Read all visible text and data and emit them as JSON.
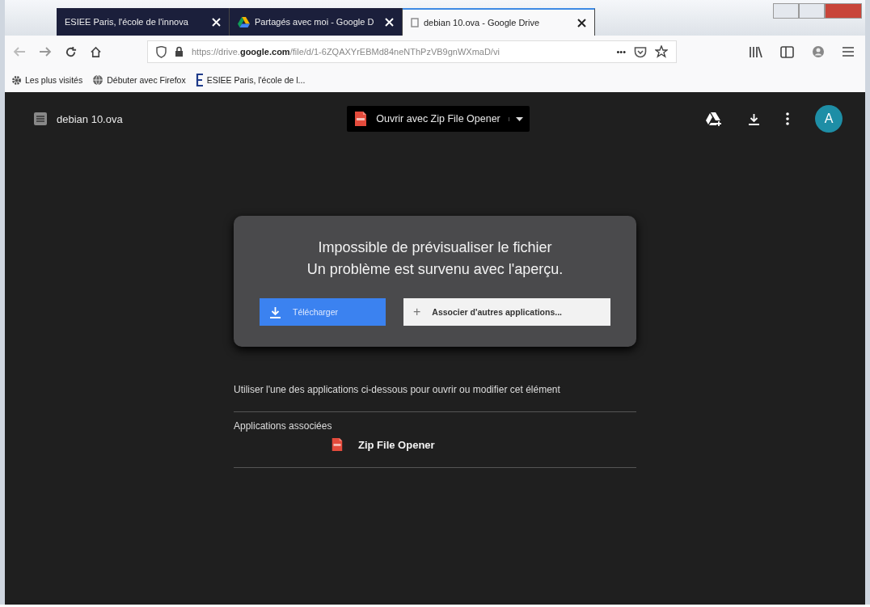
{
  "browser": {
    "tabs": [
      {
        "label": "ESIEE Paris, l'école de l'innova",
        "selected": false
      },
      {
        "label": "Partagés avec moi - Google D",
        "selected": false
      },
      {
        "label": "debian 10.ova - Google Drive",
        "selected": true
      }
    ],
    "url": {
      "prefix": "https://drive.",
      "domain": "google.com",
      "rest": "/file/d/1-6ZQAXYrEBMd84neNThPzVB9gnWXmaD/vi"
    },
    "overflow": "•••",
    "bookmarks": [
      {
        "label": "Les plus visités"
      },
      {
        "label": "Débuter avec Firefox"
      },
      {
        "label": "ESIEE Paris, l'école de l..."
      }
    ]
  },
  "drive": {
    "file_name": "debian 10.ova",
    "open_with": "Ouvrir avec Zip File Opener",
    "avatar": "A",
    "error": {
      "title": "Impossible de prévisualiser le fichier",
      "message": "Un problème est survenu avec l'aperçu.",
      "download": "Télécharger",
      "associate_icon": "+",
      "associate": "Associer d'autres applications..."
    },
    "apps_intro": "Utiliser l'une des applications ci-dessous pour ouvrir ou modifier cet élément",
    "apps_heading": "Applications associées",
    "apps": [
      {
        "name": "Zip File Opener"
      }
    ]
  }
}
